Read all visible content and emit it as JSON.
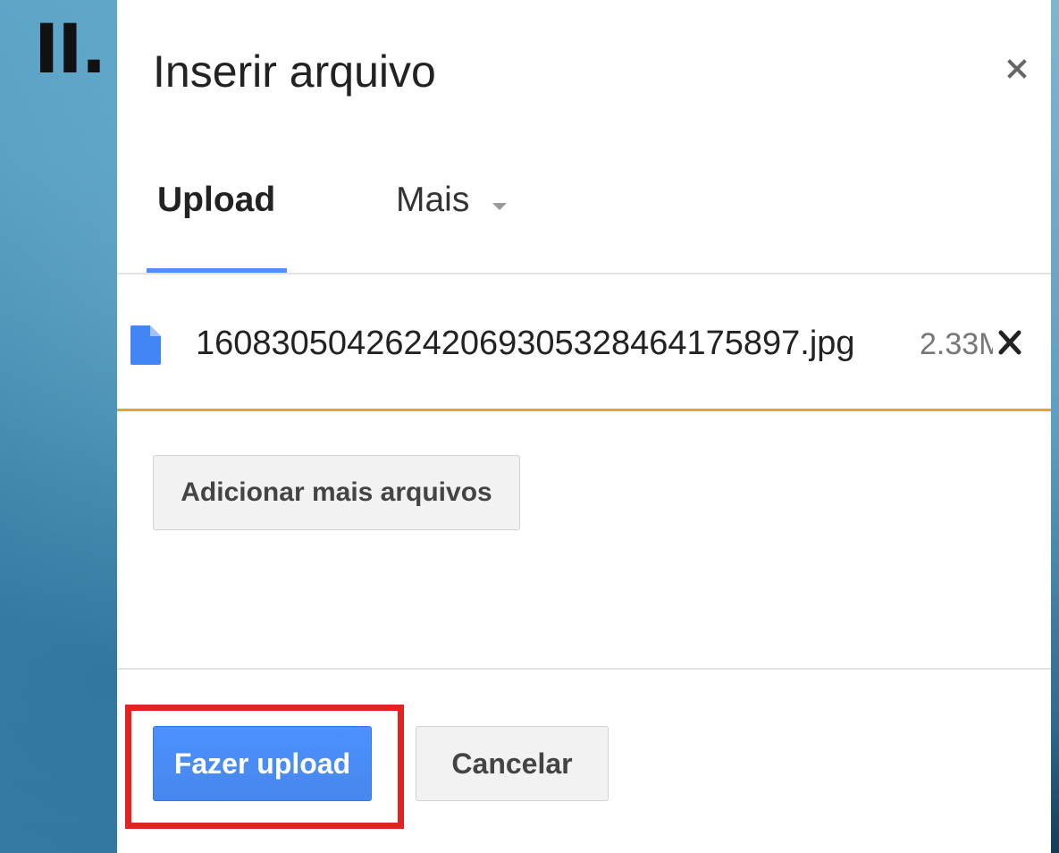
{
  "annotation": {
    "step_label": "II.",
    "highlight_color": "#e32222"
  },
  "dialog": {
    "title": "Inserir arquivo",
    "close_icon": "close-icon",
    "tabs": [
      {
        "label": "Upload",
        "active": true
      },
      {
        "label": "Mais",
        "has_dropdown": true
      }
    ],
    "files": [
      {
        "icon": "file-icon",
        "name": "1608305042624206930532846417589 7.jpg",
        "size": "2.33M",
        "remove_icon": "remove-file-icon"
      }
    ],
    "add_more_label": "Adicionar mais arquivos",
    "primary_button_label": "Fazer upload",
    "secondary_button_label": "Cancelar"
  },
  "colors": {
    "accent_blue": "#4d90fe",
    "progress_amber": "#e0a92c",
    "primary_button": "#4787ed"
  }
}
